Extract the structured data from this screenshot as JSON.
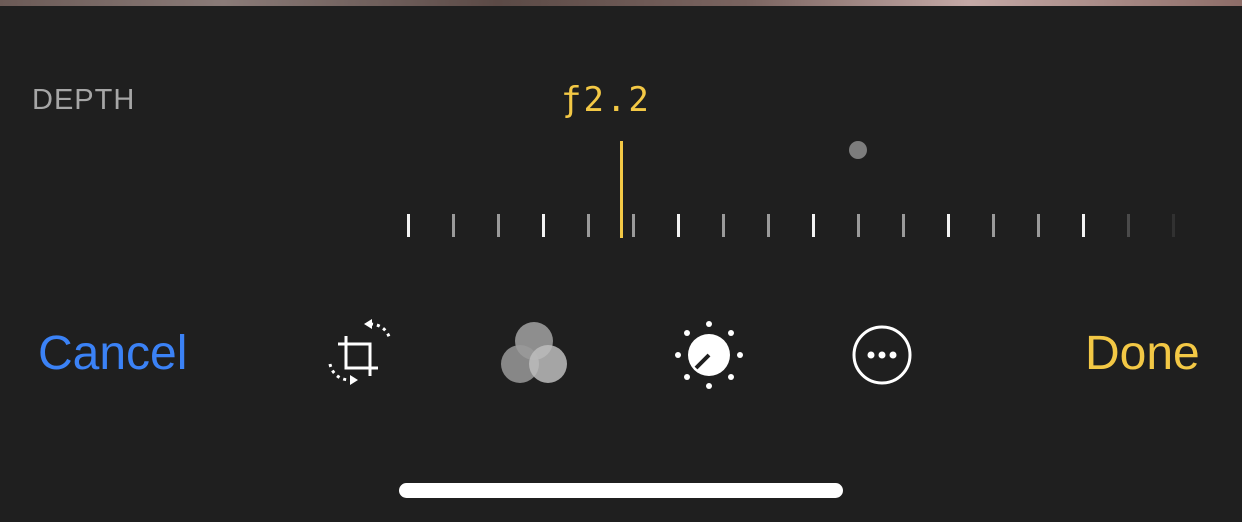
{
  "depth_label": "DEPTH",
  "aperture_value": "ƒ2.2",
  "slider": {
    "current_fstop": 2.2
  },
  "toolbar": {
    "cancel_label": "Cancel",
    "done_label": "Done",
    "tools": [
      "crop-rotate-icon",
      "filters-icon",
      "adjust-icon",
      "more-icon"
    ]
  },
  "colors": {
    "accent_yellow": "#f3c845",
    "cancel_blue": "#3b82f6",
    "background": "#1f1f1f",
    "label_gray": "#a6a6a6"
  }
}
